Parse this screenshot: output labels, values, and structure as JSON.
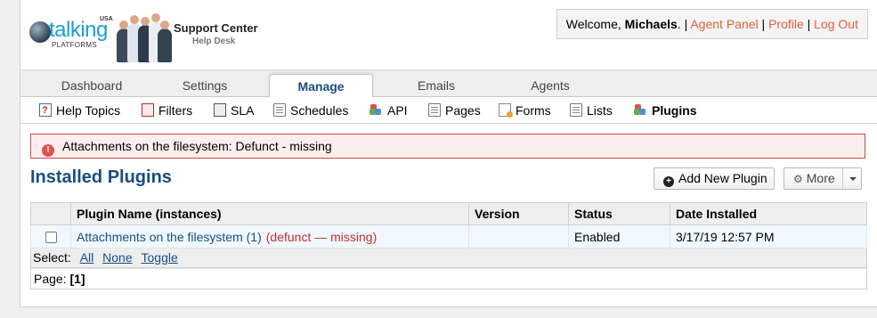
{
  "brand": {
    "logo_text": "talking",
    "logo_usa": "USA",
    "logo_sub": "PLATFORMS",
    "title": "Support Center",
    "subtitle": "Help Desk"
  },
  "welcome": {
    "prefix": "Welcome, ",
    "user": "Michaels",
    "suffix": ". | ",
    "links": [
      "Agent Panel",
      "Profile",
      "Log Out"
    ],
    "separator": " | "
  },
  "nav": {
    "tabs": [
      {
        "label": "Dashboard",
        "active": false
      },
      {
        "label": "Settings",
        "active": false
      },
      {
        "label": "Manage",
        "active": true
      },
      {
        "label": "Emails",
        "active": false
      },
      {
        "label": "Agents",
        "active": false
      }
    ]
  },
  "subnav": {
    "items": [
      {
        "label": "Help Topics",
        "icon": "help-topics-icon"
      },
      {
        "label": "Filters",
        "icon": "filters-icon"
      },
      {
        "label": "SLA",
        "icon": "sla-icon"
      },
      {
        "label": "Schedules",
        "icon": "schedules-icon"
      },
      {
        "label": "API",
        "icon": "api-icon"
      },
      {
        "label": "Pages",
        "icon": "pages-icon"
      },
      {
        "label": "Forms",
        "icon": "forms-icon"
      },
      {
        "label": "Lists",
        "icon": "lists-icon"
      },
      {
        "label": "Plugins",
        "icon": "plugins-icon",
        "active": true
      }
    ]
  },
  "alert": {
    "icon": "!",
    "text": "Attachments on the filesystem: Defunct - missing"
  },
  "page": {
    "title": "Installed Plugins",
    "add_button": "Add New Plugin",
    "more_button": "More"
  },
  "table": {
    "headers": [
      "Plugin Name (instances)",
      "Version",
      "Status",
      "Date Installed"
    ],
    "rows": [
      {
        "name": "Attachments on the filesystem (1)",
        "note": "(defunct — missing)",
        "version": "",
        "status": "Enabled",
        "date": "3/17/19 12:57 PM"
      }
    ]
  },
  "select": {
    "label": "Select:",
    "options": [
      "All",
      "None",
      "Toggle"
    ]
  },
  "pager": {
    "label": "Page:",
    "current": "[1]"
  },
  "colors": {
    "accent": "#184e81",
    "link_orange": "#e0603d",
    "error": "#c0302c"
  }
}
